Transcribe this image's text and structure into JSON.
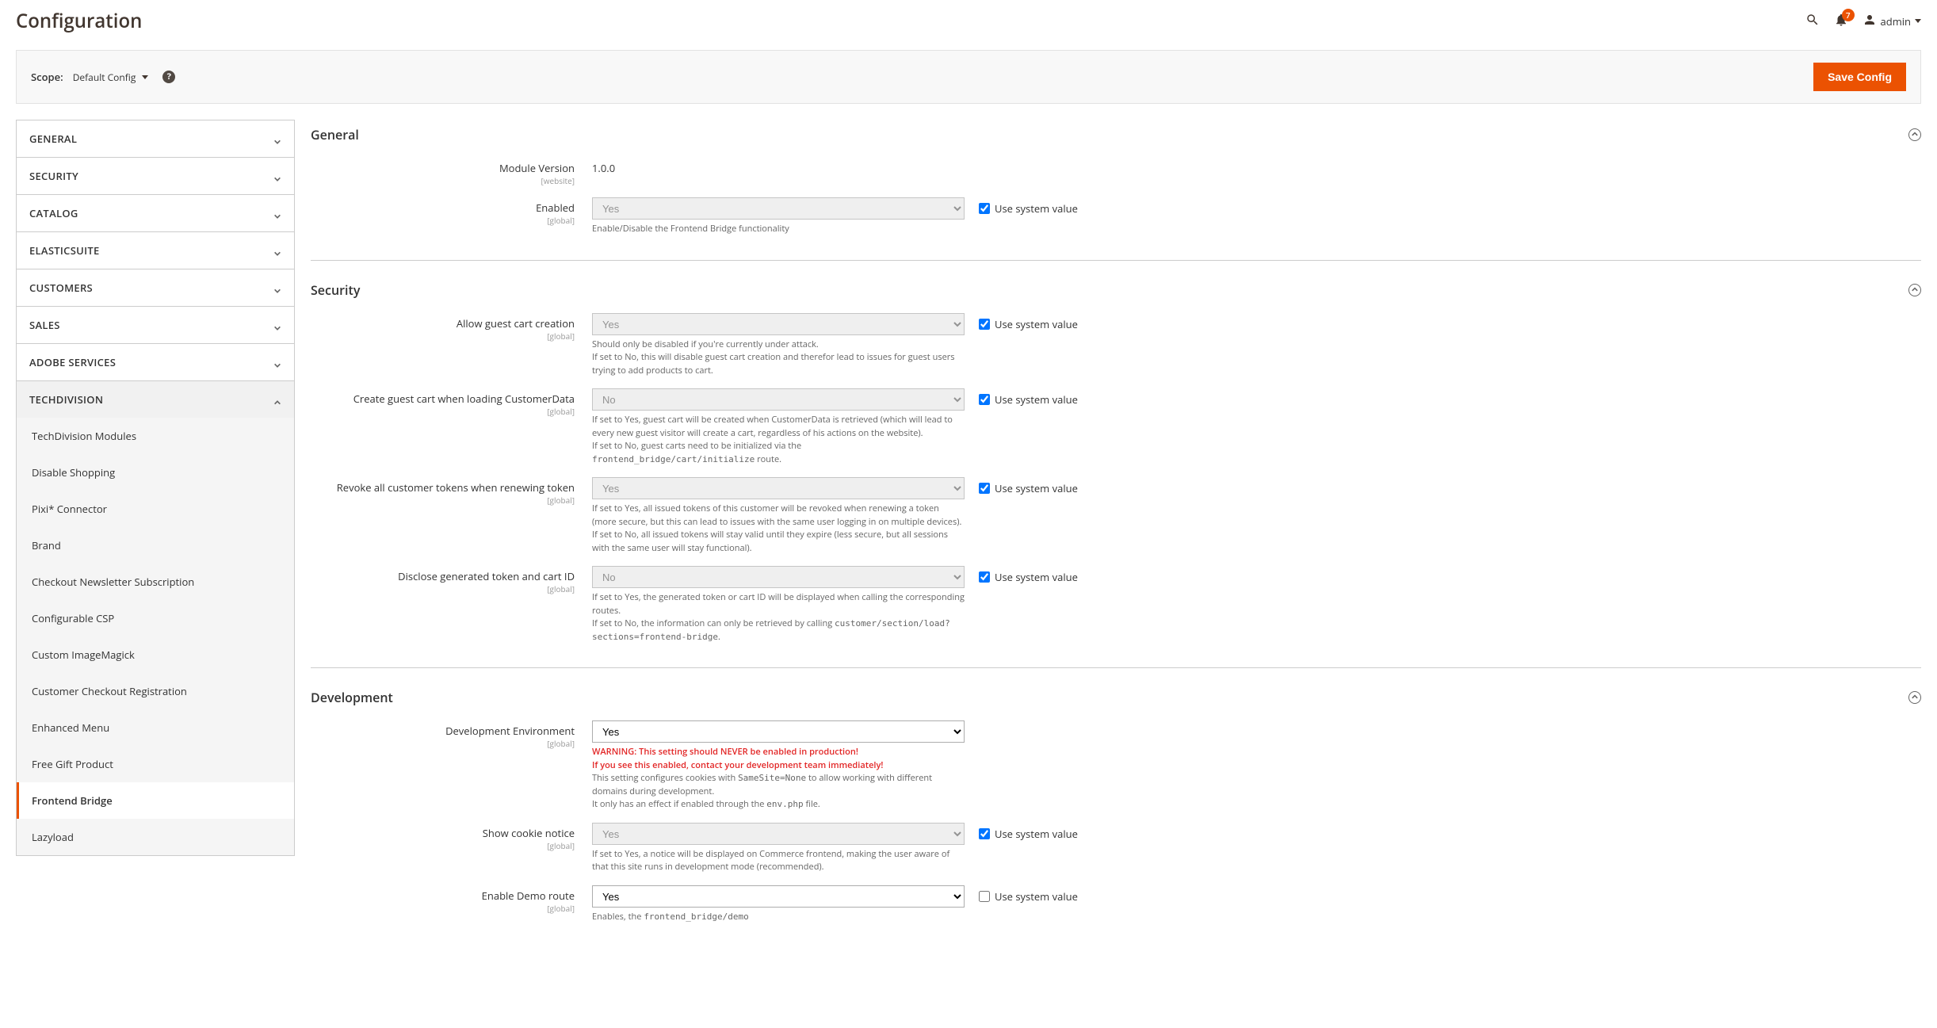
{
  "header": {
    "title": "Configuration",
    "notif_count": "7",
    "admin_user": "admin"
  },
  "scope": {
    "label": "Scope:",
    "value": "Default Config"
  },
  "save_label": "Save Config",
  "sidebar_tabs": [
    {
      "label": "GENERAL",
      "expanded": false
    },
    {
      "label": "SECURITY",
      "expanded": false
    },
    {
      "label": "CATALOG",
      "expanded": false
    },
    {
      "label": "ELASTICSUITE",
      "expanded": false
    },
    {
      "label": "CUSTOMERS",
      "expanded": false
    },
    {
      "label": "SALES",
      "expanded": false
    },
    {
      "label": "ADOBE SERVICES",
      "expanded": false
    },
    {
      "label": "TECHDIVISION",
      "expanded": true
    }
  ],
  "sidebar_sub": [
    {
      "label": "TechDivision Modules",
      "selected": false
    },
    {
      "label": "Disable Shopping",
      "selected": false
    },
    {
      "label": "Pixi* Connector",
      "selected": false
    },
    {
      "label": "Brand",
      "selected": false
    },
    {
      "label": "Checkout Newsletter Subscription",
      "selected": false
    },
    {
      "label": "Configurable CSP",
      "selected": false
    },
    {
      "label": "Custom ImageMagick",
      "selected": false
    },
    {
      "label": "Customer Checkout Registration",
      "selected": false
    },
    {
      "label": "Enhanced Menu",
      "selected": false
    },
    {
      "label": "Free Gift Product",
      "selected": false
    },
    {
      "label": "Frontend Bridge",
      "selected": true
    },
    {
      "label": "Lazyload",
      "selected": false
    }
  ],
  "sections": {
    "general": {
      "title": "General",
      "module_version": {
        "label": "Module Version",
        "scope": "[website]",
        "value": "1.0.0"
      },
      "enabled": {
        "label": "Enabled",
        "scope": "[global]",
        "value": "Yes",
        "note": "Enable/Disable the Frontend Bridge functionality",
        "use_system": true
      }
    },
    "security": {
      "title": "Security",
      "allow_guest": {
        "label": "Allow guest cart creation",
        "scope": "[global]",
        "value": "Yes",
        "use_system": true,
        "note1": "Should only be disabled if you're currently under attack.",
        "note2": "If set to No, this will disable guest cart creation and therefor lead to issues for guest users trying to add products to cart."
      },
      "create_guest": {
        "label": "Create guest cart when loading CustomerData",
        "scope": "[global]",
        "value": "No",
        "use_system": true,
        "note1": "If set to Yes, guest cart will be created when CustomerData is retrieved (which will lead to every new guest visitor will create a cart, regardless of his actions on the website).",
        "note2a": "If set to No, guest carts need to be initialized via the ",
        "note2code": "frontend_bridge/cart/initialize",
        "note2b": " route."
      },
      "revoke": {
        "label": "Revoke all customer tokens when renewing token",
        "scope": "[global]",
        "value": "Yes",
        "use_system": true,
        "note1": "If set to Yes, all issued tokens of this customer will be revoked when renewing a token (more secure, but this can lead to issues with the same user logging in on multiple devices).",
        "note2": "If set to No, all issued tokens will stay valid until they expire (less secure, but all sessions with the same user will stay functional)."
      },
      "disclose": {
        "label": "Disclose generated token and cart ID",
        "scope": "[global]",
        "value": "No",
        "use_system": true,
        "note1": "If set to Yes, the generated token or cart ID will be displayed when calling the corresponding routes.",
        "note2a": "If set to No, the information can only be retrieved by calling ",
        "note2code": "customer/section/load?sections=frontend-bridge",
        "note2b": "."
      }
    },
    "development": {
      "title": "Development",
      "dev_env": {
        "label": "Development Environment",
        "scope": "[global]",
        "value": "Yes",
        "use_system": false,
        "warn1": "WARNING: This setting should NEVER be enabled in production!",
        "warn2": "If you see this enabled, contact your development team immediately!",
        "note1a": "This setting configures cookies with ",
        "note1code": "SameSite=None",
        "note1b": " to allow working with different domains during development.",
        "note2a": "It only has an effect if enabled through the ",
        "note2code": "env.php",
        "note2b": " file."
      },
      "cookie_notice": {
        "label": "Show cookie notice",
        "scope": "[global]",
        "value": "Yes",
        "use_system": true,
        "note": "If set to Yes, a notice will be displayed on Commerce frontend, making the user aware of that this site runs in development mode (recommended)."
      },
      "demo_route": {
        "label": "Enable Demo route",
        "scope": "[global]",
        "value": "Yes",
        "use_system": false,
        "note_a": "Enables, the ",
        "note_code": "frontend_bridge/demo"
      }
    }
  },
  "use_system_label": "Use system value"
}
